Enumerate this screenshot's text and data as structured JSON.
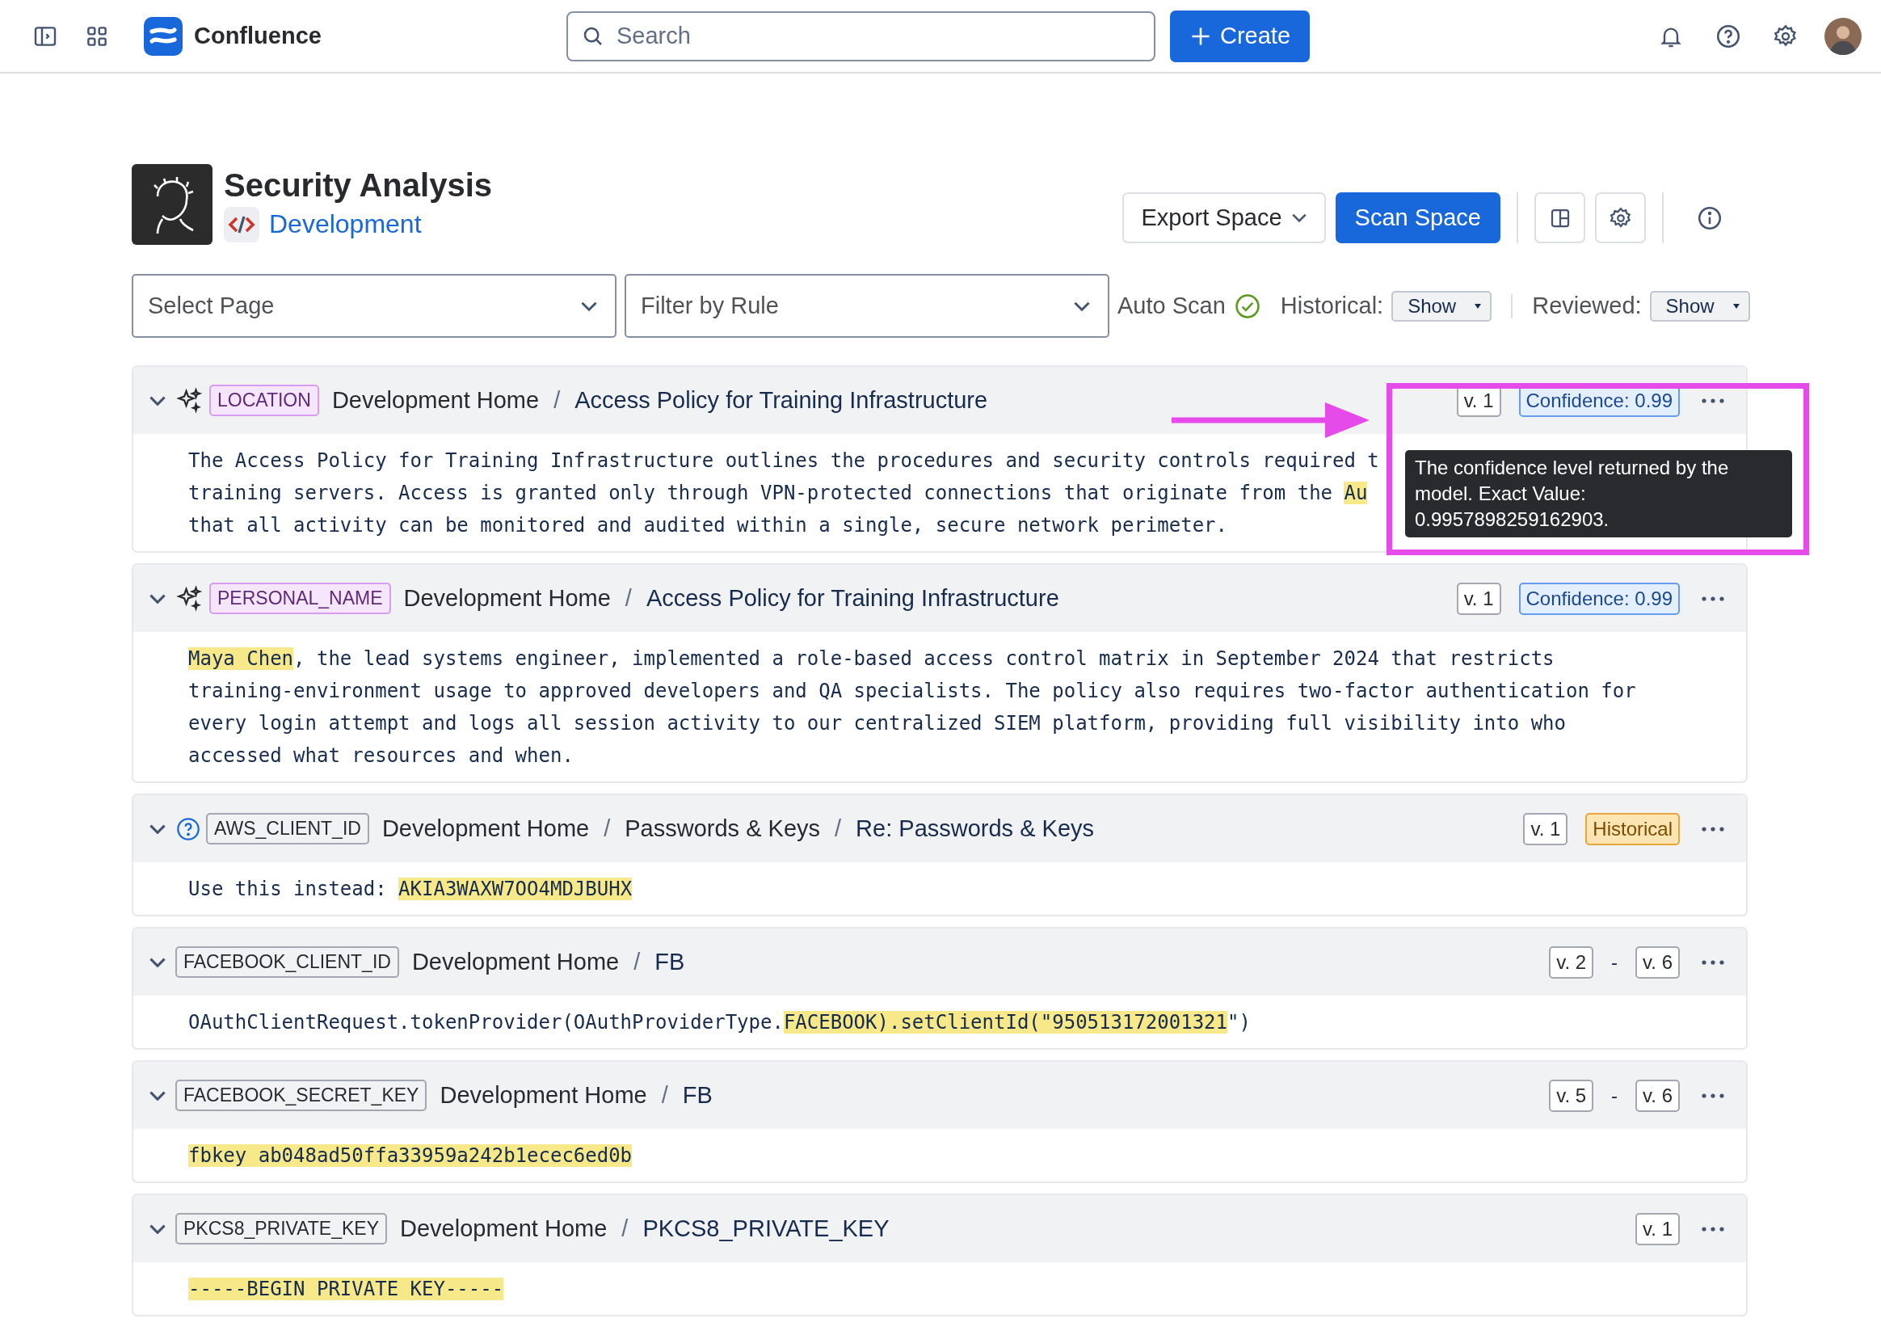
{
  "topbar": {
    "product": "Confluence",
    "search": {
      "placeholder": "Search"
    },
    "create": "Create"
  },
  "space": {
    "title": "Security Analysis",
    "link": "Development",
    "export": "Export Space",
    "scan": "Scan Space"
  },
  "filters": {
    "page": {
      "placeholder": "Select Page"
    },
    "rule": {
      "placeholder": "Filter by Rule"
    },
    "auto_scan": {
      "label": "Auto Scan",
      "on": true
    },
    "historical": {
      "label": "Historical:",
      "value": "Show"
    },
    "reviewed": {
      "label": "Reviewed:",
      "value": "Show"
    }
  },
  "findings": [
    {
      "kind": "ai",
      "expanded": true,
      "tag": "LOCATION",
      "path": [
        {
          "kind": "page",
          "text": "Development Home"
        },
        {
          "kind": "separator",
          "text": "/"
        },
        {
          "kind": "current",
          "text": "Access Policy for Training Infrastructure"
        }
      ],
      "badges": [
        {
          "kind": "version",
          "text": "v. 1"
        },
        {
          "kind": "confidence",
          "text": "Confidence: 0.99"
        }
      ],
      "lines": [
        [
          {
            "text": "The Access Policy for Training Infrastructure outlines the procedures and security controls required t",
            "highlight": false
          }
        ],
        [
          {
            "text": "training servers. Access is granted only through VPN-protected connections that originate from the ",
            "highlight": false
          },
          {
            "text": "Au",
            "highlight": true
          }
        ],
        [
          {
            "text": "that all activity can be monitored and audited within a single, secure network perimeter.",
            "highlight": false
          }
        ]
      ]
    },
    {
      "kind": "ai",
      "expanded": true,
      "tag": "PERSONAL_NAME",
      "path": [
        {
          "kind": "page",
          "text": "Development Home"
        },
        {
          "kind": "separator",
          "text": "/"
        },
        {
          "kind": "current",
          "text": "Access Policy for Training Infrastructure"
        }
      ],
      "badges": [
        {
          "kind": "version",
          "text": "v. 1"
        },
        {
          "kind": "confidence",
          "text": "Confidence: 0.99"
        }
      ],
      "lines": [
        [
          {
            "text": "Maya Chen",
            "highlight": true
          },
          {
            "text": ", the lead systems engineer, implemented a role-based access control matrix in September 2024 that restricts",
            "highlight": false
          }
        ],
        [
          {
            "text": "training-environment usage to approved developers and QA specialists. The policy also requires two-factor authentication for",
            "highlight": false
          }
        ],
        [
          {
            "text": "every login attempt and logs all session activity to our centralized SIEM platform, providing full visibility into who",
            "highlight": false
          }
        ],
        [
          {
            "text": "accessed what resources and when.",
            "highlight": false
          }
        ]
      ]
    },
    {
      "kind": "unknown",
      "expanded": true,
      "tag": "AWS_CLIENT_ID",
      "path": [
        {
          "kind": "page",
          "text": "Development Home"
        },
        {
          "kind": "separator",
          "text": "/"
        },
        {
          "kind": "page",
          "text": "Passwords & Keys"
        },
        {
          "kind": "separator",
          "text": "/"
        },
        {
          "kind": "current",
          "text": "Re: Passwords & Keys"
        }
      ],
      "badges": [
        {
          "kind": "version",
          "text": "v. 1"
        },
        {
          "kind": "historical",
          "text": "Historical"
        }
      ],
      "lines": [
        [
          {
            "text": "Use this instead: ",
            "highlight": false
          },
          {
            "text": "AKIA3WAXW7OO4MDJBUHX",
            "highlight": true
          }
        ]
      ]
    },
    {
      "kind": "pattern",
      "expanded": true,
      "tag": "FACEBOOK_CLIENT_ID",
      "path": [
        {
          "kind": "page",
          "text": "Development Home"
        },
        {
          "kind": "separator",
          "text": "/"
        },
        {
          "kind": "current",
          "text": "FB"
        }
      ],
      "badges": [
        {
          "kind": "version",
          "text": "v. 2"
        },
        {
          "kind": "separator",
          "text": "-"
        },
        {
          "kind": "version",
          "text": "v. 6"
        }
      ],
      "lines": [
        [
          {
            "text": "OAuthClientRequest.tokenProvider(OAuthProviderType.",
            "highlight": false
          },
          {
            "text": "FACEBOOK).setClientId(\"950513172001321",
            "highlight": true
          },
          {
            "text": "\")",
            "highlight": false
          }
        ]
      ]
    },
    {
      "kind": "pattern",
      "expanded": true,
      "tag": "FACEBOOK_SECRET_KEY",
      "path": [
        {
          "kind": "page",
          "text": "Development Home"
        },
        {
          "kind": "separator",
          "text": "/"
        },
        {
          "kind": "current",
          "text": "FB"
        }
      ],
      "badges": [
        {
          "kind": "version",
          "text": "v. 5"
        },
        {
          "kind": "separator",
          "text": "-"
        },
        {
          "kind": "version",
          "text": "v. 6"
        }
      ],
      "lines": [
        [
          {
            "text": "fbkey ab048ad50ffa33959a242b1ecec6ed0b",
            "highlight": true
          }
        ]
      ]
    },
    {
      "kind": "pattern",
      "expanded": true,
      "tag": "PKCS8_PRIVATE_KEY",
      "path": [
        {
          "kind": "page",
          "text": "Development Home"
        },
        {
          "kind": "separator",
          "text": "/"
        },
        {
          "kind": "current",
          "text": "PKCS8_PRIVATE_KEY"
        }
      ],
      "badges": [
        {
          "kind": "version",
          "text": "v. 1"
        }
      ],
      "lines": [
        [
          {
            "text": "-----BEGIN PRIVATE KEY-----",
            "highlight": true
          }
        ]
      ]
    }
  ],
  "tooltip": {
    "text": "The confidence level returned by the model. Exact Value: 0.9957898259162903."
  }
}
